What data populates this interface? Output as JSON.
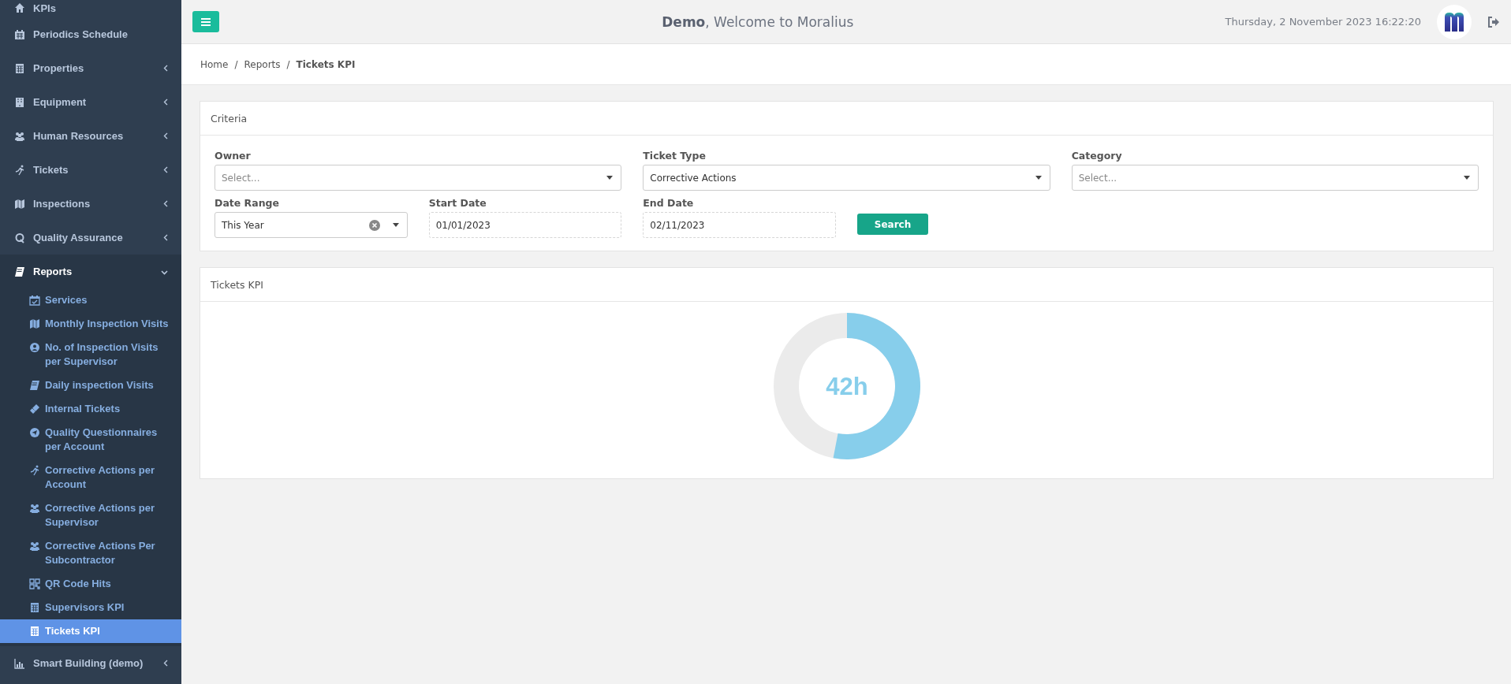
{
  "sidebar": {
    "items": [
      {
        "label": "KPIs",
        "kind": "link"
      },
      {
        "label": "Periodics Schedule",
        "kind": "link"
      },
      {
        "label": "Properties",
        "kind": "menu",
        "expanded": false
      },
      {
        "label": "Equipment",
        "kind": "menu",
        "expanded": false
      },
      {
        "label": "Human Resources",
        "kind": "menu",
        "expanded": false
      },
      {
        "label": "Tickets",
        "kind": "menu",
        "expanded": false
      },
      {
        "label": "Inspections",
        "kind": "menu",
        "expanded": false
      },
      {
        "label": "Quality Assurance",
        "kind": "menu",
        "expanded": false
      },
      {
        "label": "Reports",
        "kind": "menu",
        "expanded": true,
        "children": [
          {
            "label": "Services",
            "selected": false
          },
          {
            "label": "Monthly Inspection Visits",
            "selected": false
          },
          {
            "label": "No. of Inspection Visits per Supervisor",
            "selected": false
          },
          {
            "label": "Daily inspection Visits",
            "selected": false
          },
          {
            "label": "Internal Tickets",
            "selected": false
          },
          {
            "label": "Quality Questionnaires per Account",
            "selected": false
          },
          {
            "label": "Corrective Actions per Account",
            "selected": false
          },
          {
            "label": "Corrective Actions per Supervisor",
            "selected": false
          },
          {
            "label": "Corrective Actions Per Subcontractor",
            "selected": false
          },
          {
            "label": "QR Code Hits",
            "selected": false
          },
          {
            "label": "Supervisors KPI",
            "selected": false
          },
          {
            "label": "Tickets KPI",
            "selected": true
          }
        ]
      },
      {
        "label": "Smart Building (demo)",
        "kind": "menu",
        "expanded": false
      }
    ]
  },
  "header": {
    "welcome": "**Demo**, Welcome to Moralius",
    "datetime": "Thursday, 2 November 2023 16:22:20"
  },
  "breadcrumb": {
    "separator": "/",
    "items": [
      {
        "label": "Home",
        "current": false
      },
      {
        "label": "Reports",
        "current": false
      },
      {
        "label": "Tickets KPI",
        "current": true
      }
    ]
  },
  "criteria": {
    "title": "Criteria",
    "fields": [
      {
        "kind": "select",
        "label": "Owner",
        "placeholder": "Select..."
      },
      {
        "kind": "select",
        "label": "Ticket Type",
        "value": "Corrective Actions"
      },
      {
        "kind": "select",
        "label": "Category",
        "placeholder": "Select..."
      },
      {
        "kind": "select",
        "label": "Date Range",
        "value": "This Year",
        "clearable": true
      },
      {
        "kind": "date",
        "label": "Start Date",
        "value": "01/01/2023"
      },
      {
        "kind": "date",
        "label": "End Date",
        "value": "02/11/2023"
      },
      {
        "kind": "button",
        "label": "Search"
      }
    ]
  },
  "kpi": {
    "title": "Tickets KPI",
    "gauge": {
      "label": "42h"
    }
  }
}
